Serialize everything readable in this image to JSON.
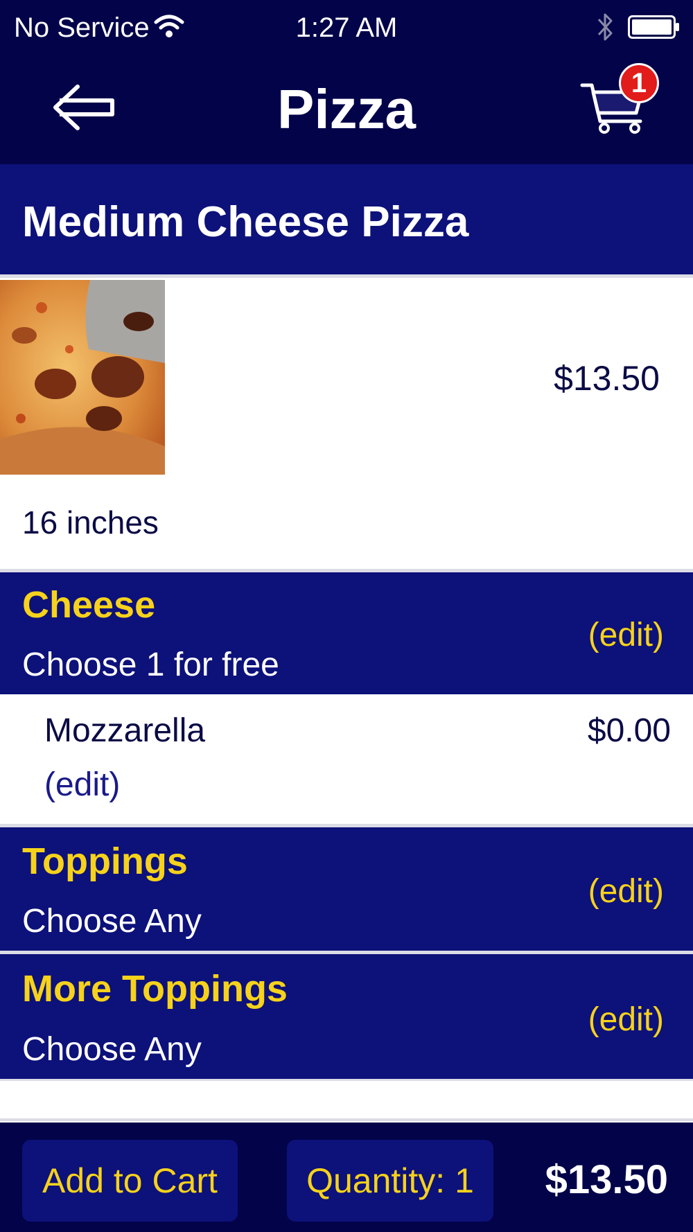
{
  "status_bar": {
    "carrier": "No Service",
    "time": "1:27 AM",
    "icons": [
      "wifi-icon",
      "bluetooth-icon",
      "battery-icon"
    ]
  },
  "nav": {
    "back_icon": "arrow-left-icon",
    "title": "Pizza",
    "cart_icon": "shopping-cart-icon",
    "cart_count": "1"
  },
  "item": {
    "name": "Medium Cheese Pizza",
    "price": "$13.50",
    "description": "16 inches",
    "photo": "pizza-photo"
  },
  "groups": [
    {
      "title": "Cheese",
      "subtitle": "Choose 1 for free",
      "edit_label": "(edit)",
      "selections": [
        {
          "name": "Mozzarella",
          "price": "$0.00",
          "edit_label": "(edit)"
        }
      ]
    },
    {
      "title": "Toppings",
      "subtitle": "Choose Any",
      "edit_label": "(edit)",
      "selections": []
    },
    {
      "title": "More Toppings",
      "subtitle": "Choose Any",
      "edit_label": "(edit)",
      "selections": []
    }
  ],
  "footer": {
    "add_to_cart_label": "Add to Cart",
    "quantity_label": "Quantity: 1",
    "total": "$13.50"
  },
  "colors": {
    "nav_bg": "#03034a",
    "section_bg": "#0d117a",
    "accent_yellow": "#f6d21b",
    "badge_red": "#e21b1b",
    "text_dark": "#0b0b45"
  }
}
